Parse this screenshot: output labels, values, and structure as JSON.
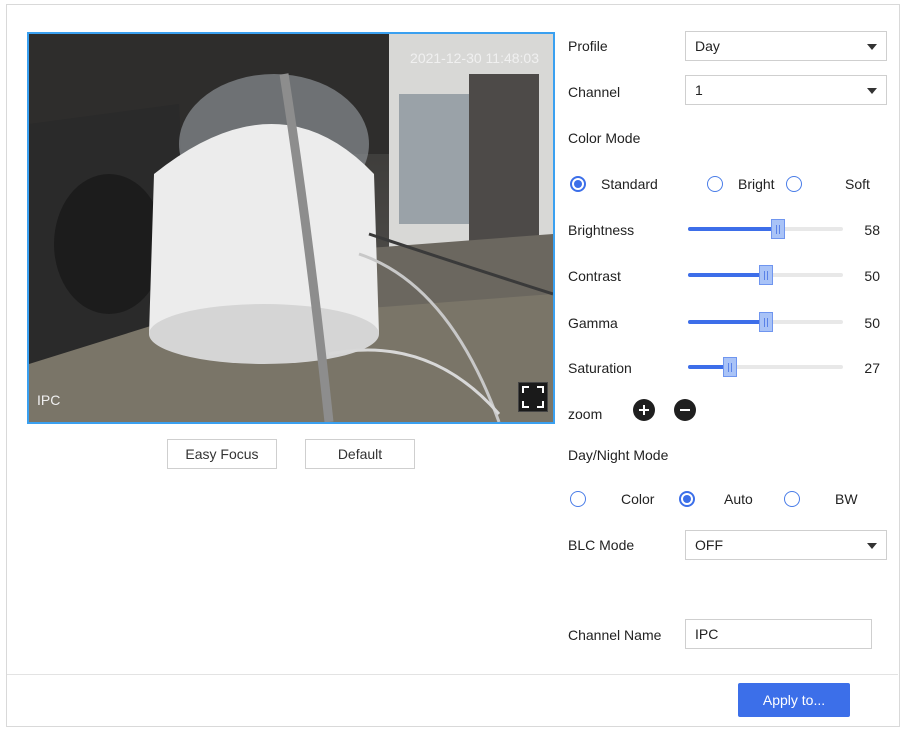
{
  "video": {
    "timestamp": "2021-12-30 11:48:03",
    "channel_label": "IPC",
    "fullscreen_icon": "fullscreen-icon"
  },
  "buttons": {
    "easy_focus": "Easy Focus",
    "default": "Default",
    "apply": "Apply to..."
  },
  "settings": {
    "profile": {
      "label": "Profile",
      "value": "Day"
    },
    "channel": {
      "label": "Channel",
      "value": "1"
    },
    "color_mode": {
      "label": "Color Mode",
      "options": [
        "Standard",
        "Bright",
        "Soft"
      ],
      "selected": "Standard"
    },
    "sliders": [
      {
        "label": "Brightness",
        "value": "58",
        "level": 58
      },
      {
        "label": "Contrast",
        "value": "50",
        "level": 50
      },
      {
        "label": "Gamma",
        "value": "50",
        "level": 50
      },
      {
        "label": "Saturation",
        "value": "27",
        "level": 27
      }
    ],
    "zoom": {
      "label": "zoom",
      "in_icon": "zoom-in-icon",
      "out_icon": "zoom-out-icon"
    },
    "day_night": {
      "label": "Day/Night Mode",
      "options": [
        "Color",
        "Auto",
        "BW"
      ],
      "selected": "Auto"
    },
    "blc": {
      "label": "BLC Mode",
      "value": "OFF"
    },
    "channel_name": {
      "label": "Channel Name",
      "value": "IPC"
    }
  },
  "colors": {
    "accent": "#3c6fe9",
    "video_border": "#3aa0f0"
  }
}
